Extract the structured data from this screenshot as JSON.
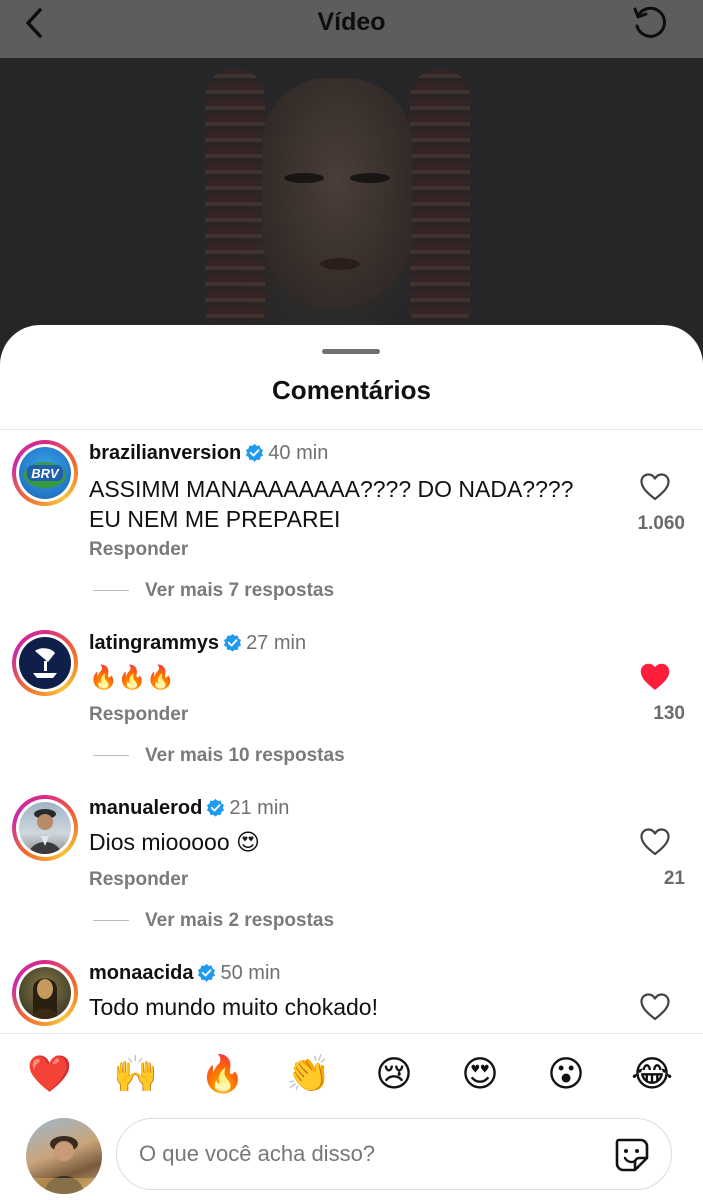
{
  "header": {
    "title": "Vídeo",
    "back_icon": "chevron-left-icon",
    "refresh_icon": "refresh-icon"
  },
  "sheet": {
    "title": "Comentários"
  },
  "comments": [
    {
      "username": "brazilianversion",
      "time": "40 min",
      "text": "ASSIMM MANAAAAAAAA???? DO NADA???? EU NEM ME PREPAREI",
      "reply_label": "Responder",
      "more_replies": "Ver mais 7 respostas",
      "likes": "1.060",
      "liked": false,
      "avatar_text": "BRV"
    },
    {
      "username": "latingrammys",
      "time": "27 min",
      "text": "🔥🔥🔥",
      "reply_label": "Responder",
      "more_replies": "Ver mais 10 respostas",
      "likes": "130",
      "liked": true
    },
    {
      "username": "manualerod",
      "time": "21 min",
      "text": "Dios miooooo 😍",
      "reply_label": "Responder",
      "more_replies": "Ver mais 2 respostas",
      "likes": "21",
      "liked": false
    },
    {
      "username": "monaacida",
      "time": "50 min",
      "text": "Todo mundo muito chokado!",
      "liked": false
    }
  ],
  "reactions": [
    "❤️",
    "🙌",
    "🔥",
    "👏",
    "😢",
    "😍",
    "😮",
    "😂"
  ],
  "composer": {
    "placeholder": "O que você acha disso?",
    "sticker_icon": "sticker-icon"
  },
  "colors": {
    "verified": "#1d9bf0",
    "liked_heart": "#ff1f3d",
    "ring_start": "#d92b86",
    "ring_end": "#f7c43a"
  }
}
